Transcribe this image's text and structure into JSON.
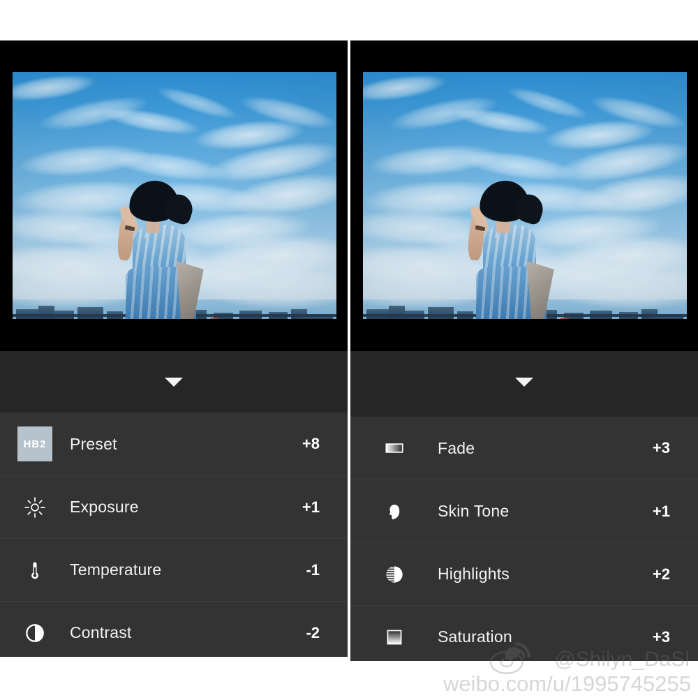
{
  "app": {
    "name": "vsco-photo-editor-comparison",
    "background_color": "#ffffff",
    "panel_background": "#000000",
    "collapse_bar_color": "#262626",
    "row_color": "#333333",
    "row_divider_color": "#3d3d3d",
    "text_color": "#f2f2f2",
    "preset_chip_color": "#b6c2cc"
  },
  "panels": [
    {
      "id": "left-panel",
      "photo": {
        "alt_description": "Woman in blue patterned dress standing with hand raised to her hair against a bright blue sky with wispy cirrus clouds and a distant city skyline",
        "dominant_sky_color": "#5aa9de",
        "dress_color": "#6fa9d6"
      },
      "collapse": {
        "icon": "chevron-down-icon"
      },
      "adjustments": [
        {
          "icon": "preset-chip",
          "chip_label": "HB2",
          "label": "Preset",
          "value": "+8"
        },
        {
          "icon": "sun-icon",
          "label": "Exposure",
          "value": "+1"
        },
        {
          "icon": "thermometer-icon",
          "label": "Temperature",
          "value": "-1"
        },
        {
          "icon": "contrast-icon",
          "label": "Contrast",
          "value": "-2"
        }
      ]
    },
    {
      "id": "right-panel",
      "photo": {
        "alt_description": "Woman in blue patterned dress standing with hand raised to her hair against a bright blue sky with wispy cirrus clouds and a distant city skyline",
        "dominant_sky_color": "#5aa9de",
        "dress_color": "#6fa9d6"
      },
      "collapse": {
        "icon": "chevron-down-icon"
      },
      "adjustments": [
        {
          "icon": "fade-icon",
          "label": "Fade",
          "value": "+3"
        },
        {
          "icon": "skin-tone-icon",
          "label": "Skin Tone",
          "value": "+1"
        },
        {
          "icon": "highlights-icon",
          "label": "Highlights",
          "value": "+2"
        },
        {
          "icon": "saturation-icon",
          "label": "Saturation",
          "value": "+3"
        }
      ]
    }
  ],
  "watermark": {
    "logo_icon": "weibo-eye-icon",
    "handle": "@Shilyn_DaSl",
    "url": "weibo.com/u/1995745255",
    "color": "rgba(120,120,120,.30)"
  }
}
